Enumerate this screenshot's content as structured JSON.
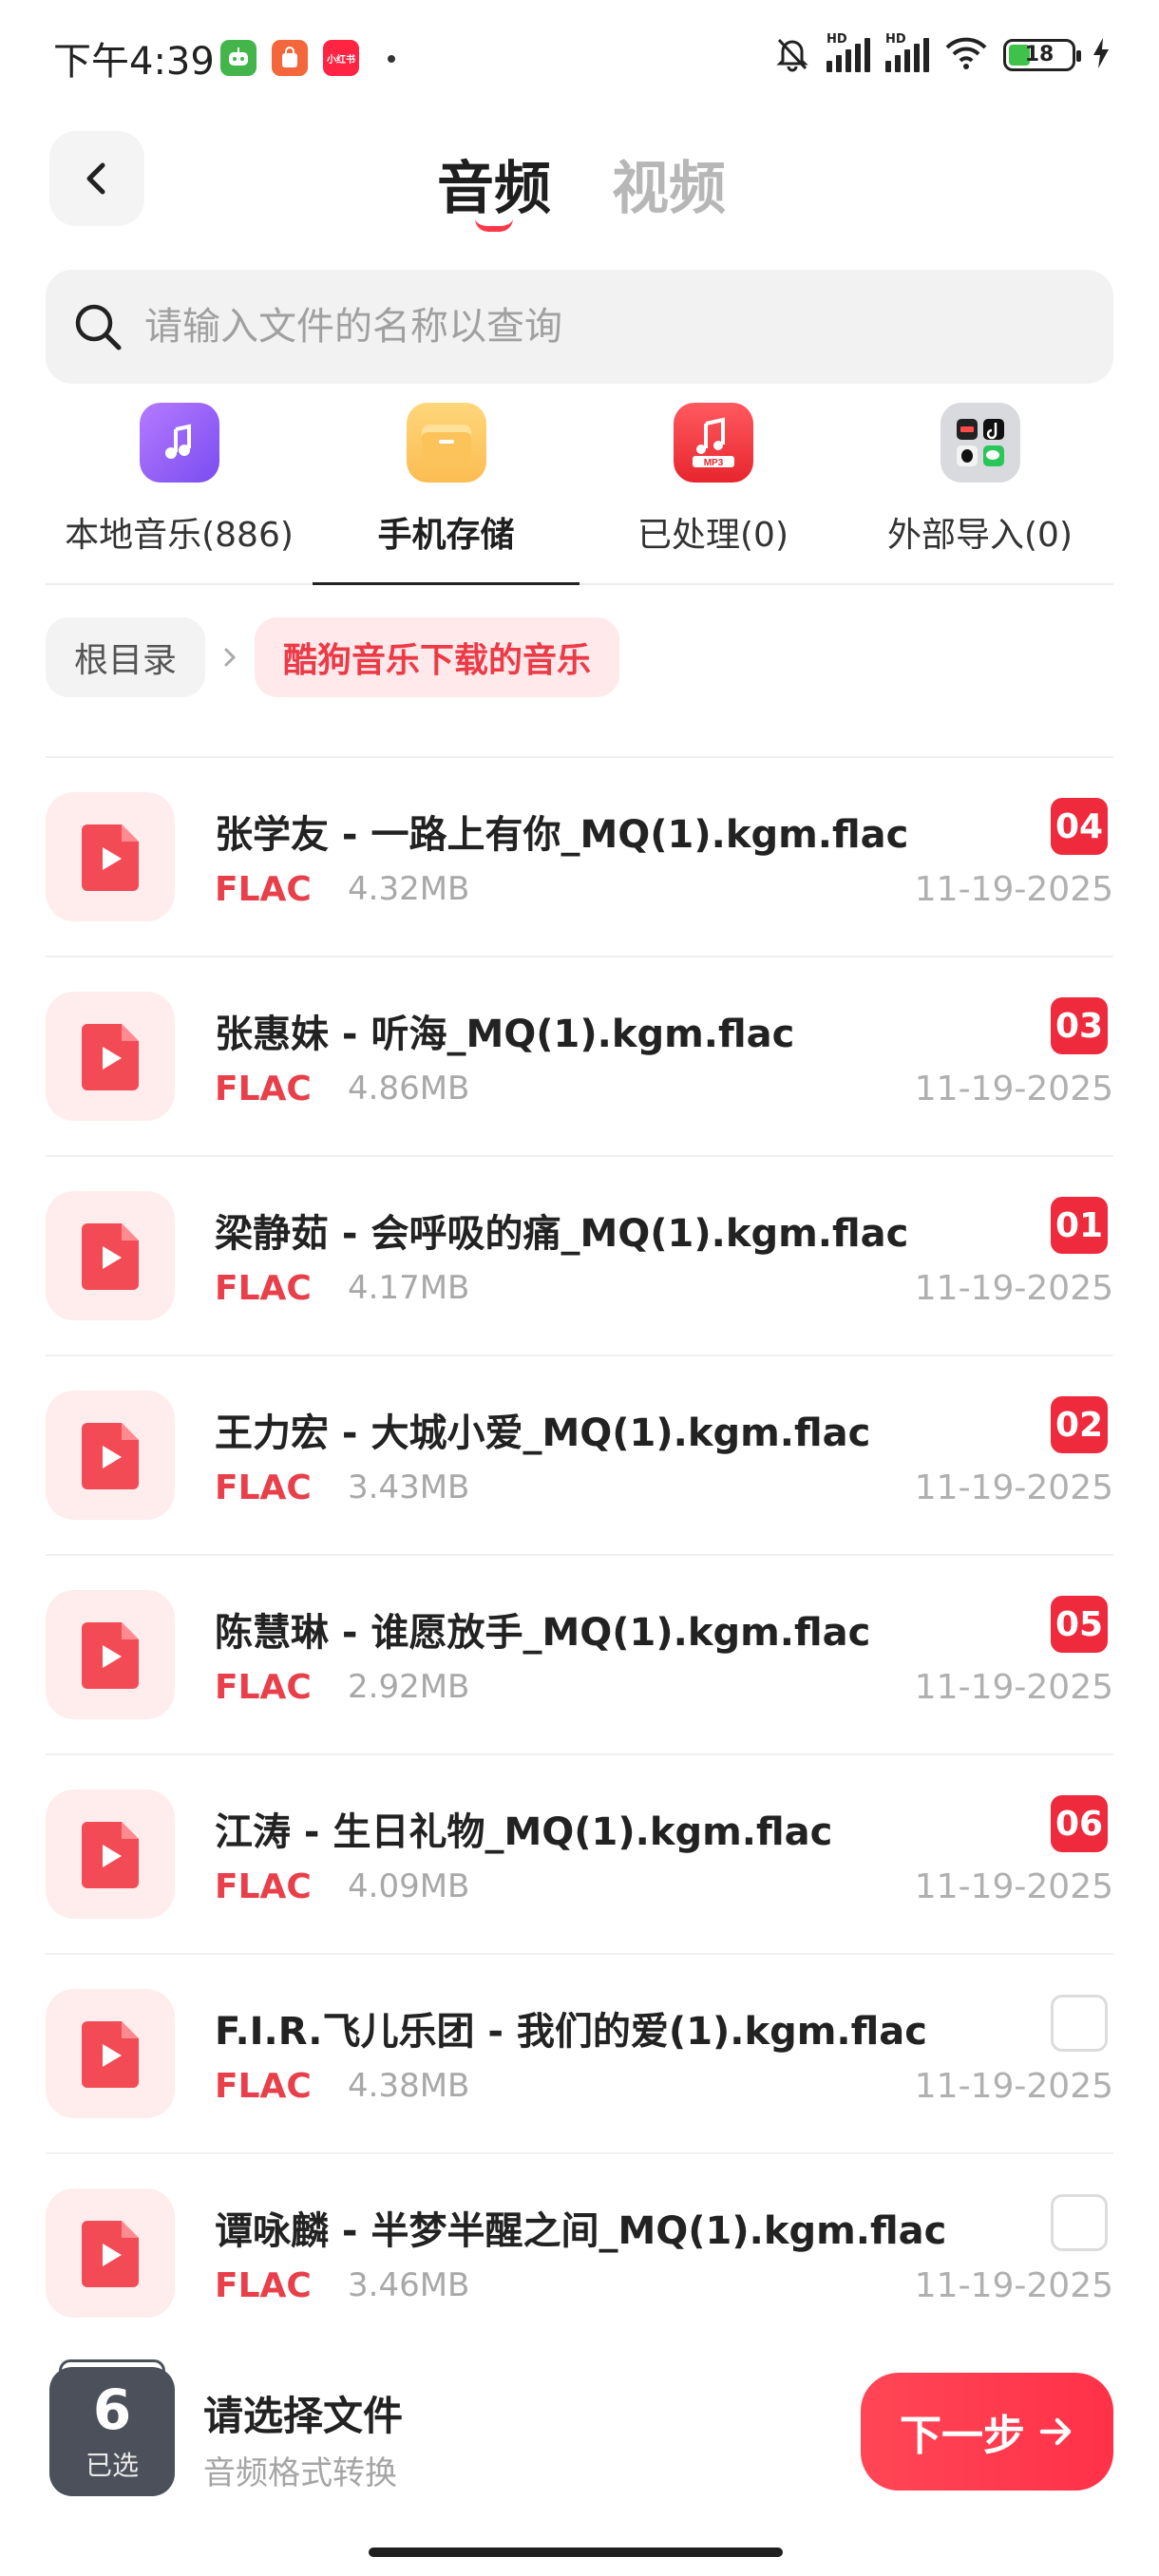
{
  "status_bar": {
    "time": "下午4:39",
    "app_badge_3": "小红书",
    "network_label": "HD",
    "battery": "18"
  },
  "header": {
    "tabs": [
      {
        "label": "音频",
        "active": true
      },
      {
        "label": "视频",
        "active": false
      }
    ]
  },
  "search": {
    "placeholder": "请输入文件的名称以查询"
  },
  "sources": [
    {
      "label": "本地音乐(886)",
      "icon": "music-note-icon",
      "active": false
    },
    {
      "label": "手机存储",
      "icon": "folder-icon",
      "active": true
    },
    {
      "label": "已处理(0)",
      "icon": "mp3-icon",
      "active": false
    },
    {
      "label": "外部导入(0)",
      "icon": "apps-grid-icon",
      "active": false
    }
  ],
  "breadcrumb": {
    "root": "根目录",
    "current": "酷狗音乐下载的音乐"
  },
  "files": [
    {
      "name": "张学友 - 一路上有你_MQ(1).kgm.flac",
      "format": "FLAC",
      "size": "4.32MB",
      "date": "11-19-2025",
      "badge": "04",
      "selected": true
    },
    {
      "name": "张惠妹 - 听海_MQ(1).kgm.flac",
      "format": "FLAC",
      "size": "4.86MB",
      "date": "11-19-2025",
      "badge": "03",
      "selected": true
    },
    {
      "name": "梁静茹 - 会呼吸的痛_MQ(1).kgm.flac",
      "format": "FLAC",
      "size": "4.17MB",
      "date": "11-19-2025",
      "badge": "01",
      "selected": true
    },
    {
      "name": "王力宏 - 大城小爱_MQ(1).kgm.flac",
      "format": "FLAC",
      "size": "3.43MB",
      "date": "11-19-2025",
      "badge": "02",
      "selected": true
    },
    {
      "name": "陈慧琳 - 谁愿放手_MQ(1).kgm.flac",
      "format": "FLAC",
      "size": "2.92MB",
      "date": "11-19-2025",
      "badge": "05",
      "selected": true
    },
    {
      "name": "江涛 - 生日礼物_MQ(1).kgm.flac",
      "format": "FLAC",
      "size": "4.09MB",
      "date": "11-19-2025",
      "badge": "06",
      "selected": true
    },
    {
      "name": "F.I.R.飞儿乐团 - 我们的爱(1).kgm.flac",
      "format": "FLAC",
      "size": "4.38MB",
      "date": "11-19-2025",
      "badge": "",
      "selected": false
    },
    {
      "name": "谭咏麟 - 半梦半醒之间_MQ(1).kgm.flac",
      "format": "FLAC",
      "size": "3.46MB",
      "date": "11-19-2025",
      "badge": "",
      "selected": false
    }
  ],
  "bottom_bar": {
    "selected_count": "6",
    "selected_label": "已选",
    "title": "请选择文件",
    "subtitle": "音频格式转换",
    "next_label": "下一步"
  },
  "colors": {
    "accent": "#ee2a3c",
    "accent_light": "#ffecec",
    "text_primary": "#222222",
    "text_muted": "#a8a8a8"
  }
}
